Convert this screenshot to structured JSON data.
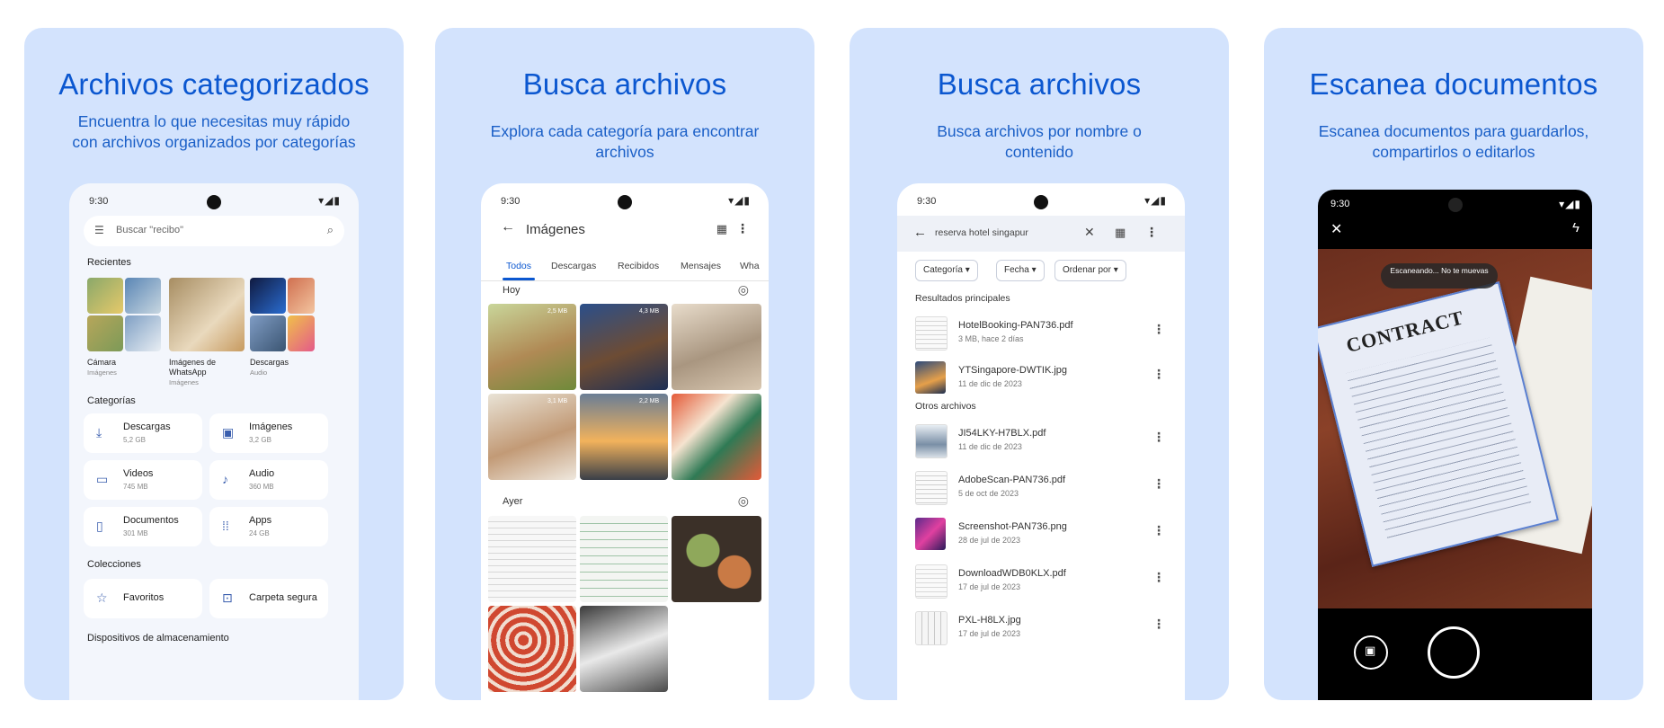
{
  "cards": [
    {
      "title": "Archivos categorizados",
      "subtitle": "Encuentra lo que necesitas muy rápido con archivos organizados por categorías",
      "phone": {
        "time": "9:30",
        "search_placeholder": "Buscar \"recibo\"",
        "recent_label": "Recientes",
        "recent": [
          {
            "label": "Cámara",
            "sub": "Imágenes"
          },
          {
            "label": "Imágenes de WhatsApp",
            "sub": "Imágenes"
          },
          {
            "label": "Descargas",
            "sub": "Audio"
          }
        ],
        "categories_label": "Categorías",
        "categories": [
          {
            "label": "Descargas",
            "size": "5,2 GB",
            "icon": "download-icon"
          },
          {
            "label": "Imágenes",
            "size": "3,2 GB",
            "icon": "image-icon"
          },
          {
            "label": "Videos",
            "size": "745 MB",
            "icon": "video-icon"
          },
          {
            "label": "Audio",
            "size": "360 MB",
            "icon": "audio-icon"
          },
          {
            "label": "Documentos",
            "size": "301 MB",
            "icon": "document-icon"
          },
          {
            "label": "Apps",
            "size": "24 GB",
            "icon": "apps-icon"
          }
        ],
        "collections_label": "Colecciones",
        "collections": [
          {
            "label": "Favoritos",
            "icon": "star-icon"
          },
          {
            "label": "Carpeta segura",
            "icon": "lock-icon"
          }
        ],
        "storage_label": "Dispositivos de almacenamiento"
      }
    },
    {
      "title": "Busca archivos",
      "subtitle": "Explora cada categoría para encontrar archivos",
      "phone": {
        "time": "9:30",
        "header_title": "Imágenes",
        "tabs": [
          "Todos",
          "Descargas",
          "Recibidos",
          "Mensajes",
          "Wha"
        ],
        "active_tab": "Todos",
        "group_today": "Hoy",
        "group_yesterday": "Ayer",
        "badges": [
          "2,5 MB",
          "4,3 MB",
          "3,1 MB",
          "2,2 MB"
        ]
      }
    },
    {
      "title": "Busca archivos",
      "subtitle": "Busca archivos por nombre o contenido",
      "phone": {
        "time": "9:30",
        "search_query": "reserva hotel singapur",
        "filters": [
          "Categoría",
          "Fecha",
          "Ordenar por"
        ],
        "top_results_label": "Resultados principales",
        "top_results": [
          {
            "name": "HotelBooking-PAN736.pdf",
            "meta": "3 MB, hace 2 días"
          },
          {
            "name": "YTSingapore-DWTIK.jpg",
            "meta": "11 de dic de 2023"
          }
        ],
        "other_files_label": "Otros archivos",
        "other_files": [
          {
            "name": "JI54LKY-H7BLX.pdf",
            "meta": "11 de dic de 2023"
          },
          {
            "name": "AdobeScan-PAN736.pdf",
            "meta": "5 de oct de 2023"
          },
          {
            "name": "Screenshot-PAN736.png",
            "meta": "28 de jul de 2023"
          },
          {
            "name": "DownloadWDB0KLX.pdf",
            "meta": "17 de jul de 2023"
          },
          {
            "name": "PXL-H8LX.jpg",
            "meta": "17 de jul de 2023"
          }
        ]
      }
    },
    {
      "title": "Escanea documentos",
      "subtitle": "Escanea documentos para guardarlos, compartirlos o editarlos",
      "phone": {
        "time": "9:30",
        "scan_hint": "Escaneando... No te muevas",
        "document_heading": "CONTRACT"
      }
    }
  ]
}
